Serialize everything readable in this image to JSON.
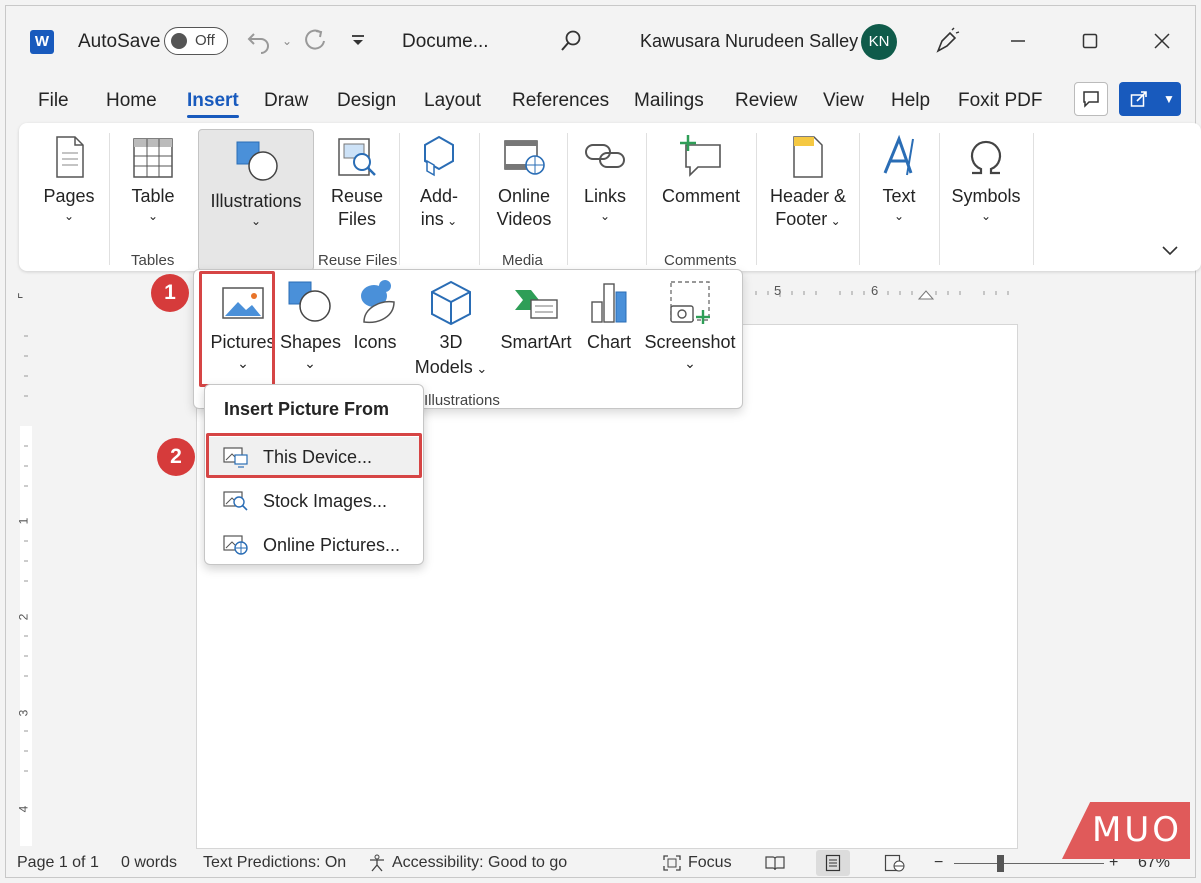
{
  "titlebar": {
    "app_icon": "W",
    "autosave_label": "AutoSave",
    "autosave_state": "Off",
    "doc_title": "Docume...",
    "user_name": "Kawusara Nurudeen Salley",
    "user_initials": "KN"
  },
  "tabs": [
    "File",
    "Home",
    "Insert",
    "Draw",
    "Design",
    "Layout",
    "References",
    "Mailings",
    "Review",
    "View",
    "Help",
    "Foxit PDF"
  ],
  "active_tab": "Insert",
  "ribbon": {
    "pages": "Pages",
    "table": "Table",
    "illustrations": "Illustrations",
    "reuse_files_1": "Reuse",
    "reuse_files_2": "Files",
    "addins_1": "Add-",
    "addins_2": "ins",
    "online_videos_1": "Online",
    "online_videos_2": "Videos",
    "links": "Links",
    "comment": "Comment",
    "header_footer_1": "Header &",
    "header_footer_2": "Footer",
    "text": "Text",
    "symbols": "Symbols",
    "groups": {
      "tables": "Tables",
      "reuse_files": "Reuse Files",
      "media": "Media",
      "comments": "Comments"
    }
  },
  "ruler": {
    "mark5": "5",
    "mark6": "6",
    "v1": "1",
    "v2": "2",
    "v3": "3",
    "v4": "4"
  },
  "illustrations_panel": {
    "pictures": "Pictures",
    "shapes": "Shapes",
    "icons": "Icons",
    "models_1": "3D",
    "models_2": "Models",
    "smartart": "SmartArt",
    "chart": "Chart",
    "screenshot": "Screenshot",
    "group_label": "Illustrations"
  },
  "steps": {
    "step1": "1",
    "step2": "2"
  },
  "submenu": {
    "title": "Insert Picture From",
    "items": [
      "This Device...",
      "Stock Images...",
      "Online Pictures..."
    ]
  },
  "status": {
    "page": "Page 1 of 1",
    "words": "0 words",
    "predictions": "Text Predictions: On",
    "accessibility": "Accessibility: Good to go",
    "focus": "Focus",
    "zoom": "67%",
    "zoom_level": 0.67
  },
  "watermark": "MUO",
  "colors": {
    "accent": "#185abd",
    "highlight": "#d64545",
    "avatar": "#0f5b4a"
  }
}
